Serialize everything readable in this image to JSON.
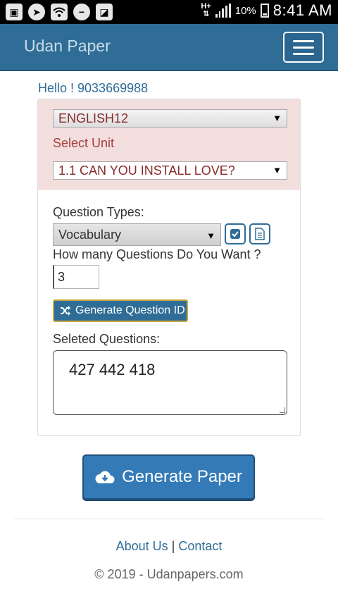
{
  "status_bar": {
    "network": "H+",
    "battery_percent": "10%",
    "time": "8:41 AM",
    "icons": [
      "gallery-icon",
      "navigation-icon",
      "wifi-icon",
      "dnd-icon",
      "image-icon"
    ]
  },
  "navbar": {
    "brand": "Udan Paper"
  },
  "greeting": "Hello ! 9033669988",
  "form": {
    "subject_value": "ENGLISH12",
    "select_unit_label": "Select Unit",
    "unit_value": "1.1 CAN YOU INSTALL LOVE?",
    "question_types_label": "Question Types:",
    "question_type_value": "Vocabulary",
    "how_many_label": "How many Questions Do You Want ?",
    "quantity_value": "3",
    "generate_id_label": "Generate Question ID",
    "selected_label": "Seleted Questions:",
    "selected_questions": "427 442 418"
  },
  "generate_paper_label": "Generate Paper",
  "footer": {
    "about": "About Us",
    "separator": "|",
    "contact": "Contact",
    "copyright": "© 2019 - Udanpapers.com"
  },
  "colors": {
    "primary": "#2f6d97",
    "button": "#337ab7",
    "alert_bg": "#f3dede",
    "alert_text": "#a4403d"
  }
}
